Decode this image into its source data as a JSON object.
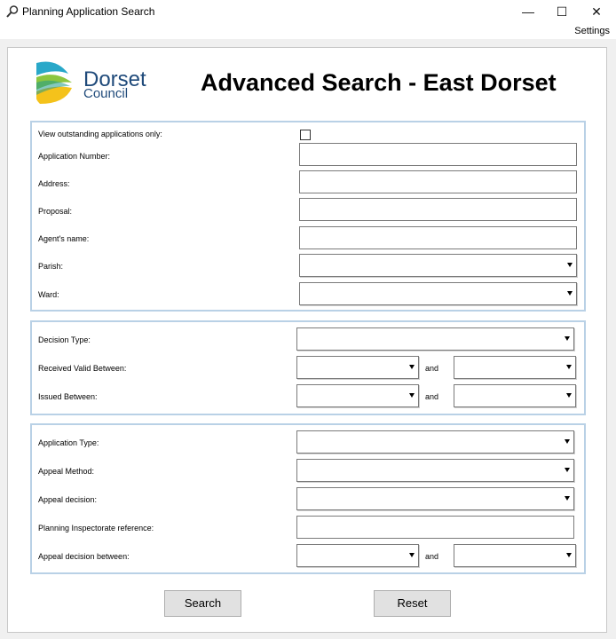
{
  "window": {
    "title": "Planning Application Search",
    "settings_label": "Settings",
    "minimize_glyph": "—",
    "maximize_glyph": "☐",
    "close_glyph": "✕"
  },
  "header": {
    "logo_line1": "Dorset",
    "logo_line2": "Council",
    "title": "Advanced Search - East Dorset"
  },
  "section1": {
    "outstanding_label": "View outstanding applications only:",
    "outstanding_checked": false,
    "application_number_label": "Application Number:",
    "application_number_value": "",
    "address_label": "Address:",
    "address_value": "",
    "proposal_label": "Proposal:",
    "proposal_value": "",
    "agent_label": "Agent's name:",
    "agent_value": "",
    "parish_label": "Parish:",
    "parish_value": "",
    "ward_label": "Ward:",
    "ward_value": ""
  },
  "section2": {
    "decision_type_label": "Decision Type:",
    "received_label": "Received Valid Between:",
    "issued_label": "Issued Between:",
    "and_label": "and"
  },
  "section3": {
    "application_type_label": "Application Type:",
    "appeal_method_label": "Appeal Method:",
    "appeal_decision_label": "Appeal decision:",
    "inspectorate_label": "Planning Inspectorate reference:",
    "inspectorate_value": "",
    "appeal_between_label": "Appeal decision between:",
    "and_label": "and"
  },
  "buttons": {
    "search": "Search",
    "reset": "Reset"
  },
  "colors": {
    "logo_text": "#1f4a7a",
    "group_border": "#b9d1e6",
    "button_face": "#e1e1e1"
  }
}
